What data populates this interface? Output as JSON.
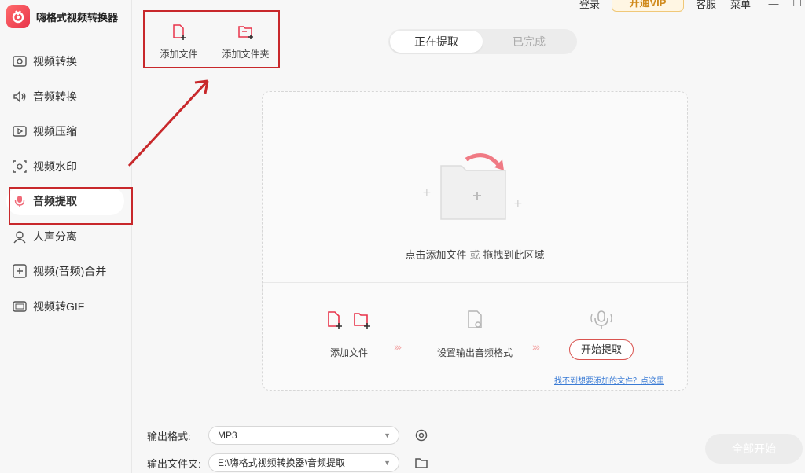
{
  "app": {
    "title": "嗨格式视频转换器"
  },
  "topbar": {
    "login": "登录",
    "vip": "开通VIP",
    "service": "客服",
    "menu": "菜单",
    "minimize": "—",
    "maximize": "☐"
  },
  "sidebar": {
    "items": [
      {
        "label": "视频转换",
        "icon": "video-convert-icon"
      },
      {
        "label": "音频转换",
        "icon": "audio-convert-icon"
      },
      {
        "label": "视频压缩",
        "icon": "video-compress-icon"
      },
      {
        "label": "视频水印",
        "icon": "watermark-icon"
      },
      {
        "label": "音频提取",
        "icon": "audio-extract-icon",
        "active": true
      },
      {
        "label": "人声分离",
        "icon": "voice-separate-icon"
      },
      {
        "label": "视频(音频)合并",
        "icon": "merge-icon"
      },
      {
        "label": "视频转GIF",
        "icon": "gif-icon"
      }
    ]
  },
  "toolbar": {
    "add_file": "添加文件",
    "add_folder": "添加文件夹"
  },
  "tabs": {
    "processing": "正在提取",
    "done": "已完成"
  },
  "dropzone": {
    "hint_click": "点击添加文件",
    "hint_or": "或",
    "hint_drag": "拖拽到此区域",
    "step1": "添加文件",
    "step2": "设置输出音频格式",
    "step3": "开始提取",
    "help": "找不到想要添加的文件？点这里"
  },
  "output": {
    "format_label": "输出格式:",
    "format_value": "MP3",
    "folder_label": "输出文件夹:",
    "folder_value": "E:\\嗨格式视频转换器\\音频提取"
  },
  "start_all": "全部开始",
  "colors": {
    "accent": "#e8334a",
    "annotation": "#c8282b"
  }
}
